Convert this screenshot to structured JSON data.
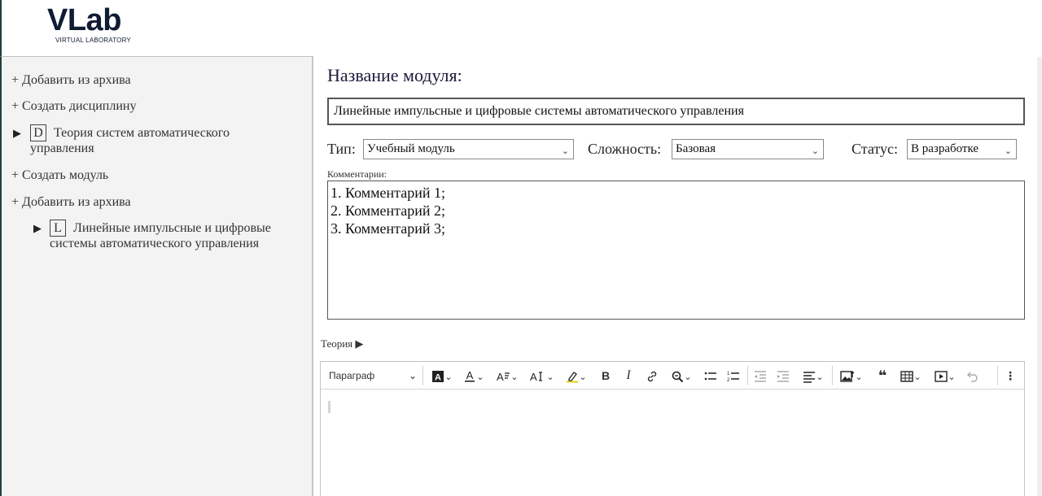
{
  "logo": {
    "main": "VLab",
    "sub": "VIRTUAL LABORATORY"
  },
  "sidebar": {
    "items": [
      {
        "label": "+ Добавить из архива"
      },
      {
        "label": "+ Создать дисциплину"
      },
      {
        "badge": "D",
        "label_line1": "Теория систем автоматического",
        "label_line2": "управления"
      },
      {
        "label": "+ Создать модуль"
      },
      {
        "label": "+ Добавить из архива"
      },
      {
        "badge": "L",
        "label_line1": "Линейные импульсные и цифровые",
        "label_line2": "системы автоматического управления"
      }
    ]
  },
  "main": {
    "title": "Название модуля:",
    "module_name": "Линейные импульсные и цифровые системы автоматического управления",
    "type": {
      "label": "Тип:",
      "value": "Учебный модуль"
    },
    "complexity": {
      "label": "Сложность:",
      "value": "Базовая"
    },
    "status": {
      "label": "Статус:",
      "value": "В разработке"
    },
    "comments_label": "Комментарии:",
    "comments": [
      "1. Комментарий 1;",
      "2. Комментарий 2;",
      "3. Комментарий 3;"
    ],
    "theory_label": "Теория ▶"
  },
  "editor": {
    "paragraph": "Параграф",
    "icons": [
      "font-background-icon",
      "font-color-icon",
      "font-size-icon",
      "font-family-icon",
      "highlight-icon",
      "bold-icon",
      "italic-icon",
      "link-icon",
      "find-replace-icon",
      "bulleted-list-icon",
      "numbered-list-icon",
      "outdent-icon",
      "indent-icon",
      "align-icon",
      "image-insert-icon",
      "blockquote-icon",
      "table-icon",
      "media-embed-icon",
      "undo-icon",
      "more-vertical-icon"
    ]
  }
}
